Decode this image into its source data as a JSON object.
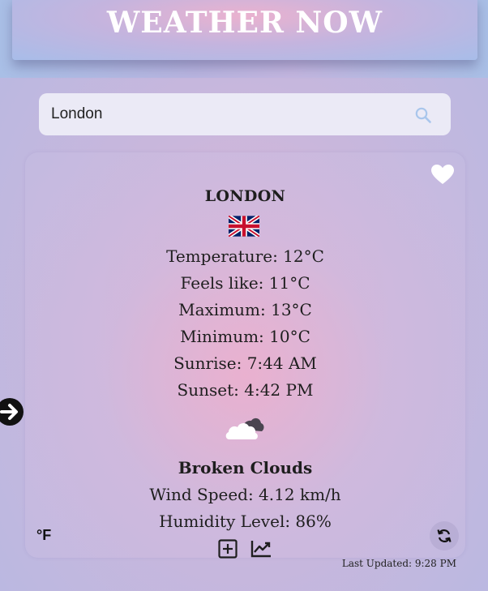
{
  "header": {
    "title": "WEATHER NOW"
  },
  "search": {
    "value": "London",
    "icon": "search-icon"
  },
  "weather_card": {
    "city": "LONDON",
    "flag": "united-kingdom-flag",
    "temperature": "Temperature: 12°C",
    "feels_like": "Feels like: 11°C",
    "maximum": "Maximum: 13°C",
    "minimum": "Minimum: 10°C",
    "sunrise": "Sunrise: 7:44 AM",
    "sunset": "Sunset: 4:42 PM",
    "condition_icon": "broken-clouds-icon",
    "description": "Broken Clouds",
    "wind_speed": "Wind Speed: 4.12 km/h",
    "humidity": "Humidity Level: 86%",
    "unit_toggle_label": "°F",
    "favorite_icon": "heart-icon",
    "refresh_icon": "refresh-icon",
    "add_icon": "plus-square-icon",
    "chart_icon": "trend-chart-icon"
  },
  "last_updated": "Last Updated: 9:28 PM",
  "nav": {
    "next_icon": "arrow-right-circle-icon"
  },
  "colors": {
    "header_text": "#ffffff",
    "search_background": "#ebeaf6",
    "search_icon": "#a9c6ec",
    "text": "#1e1e1e"
  }
}
